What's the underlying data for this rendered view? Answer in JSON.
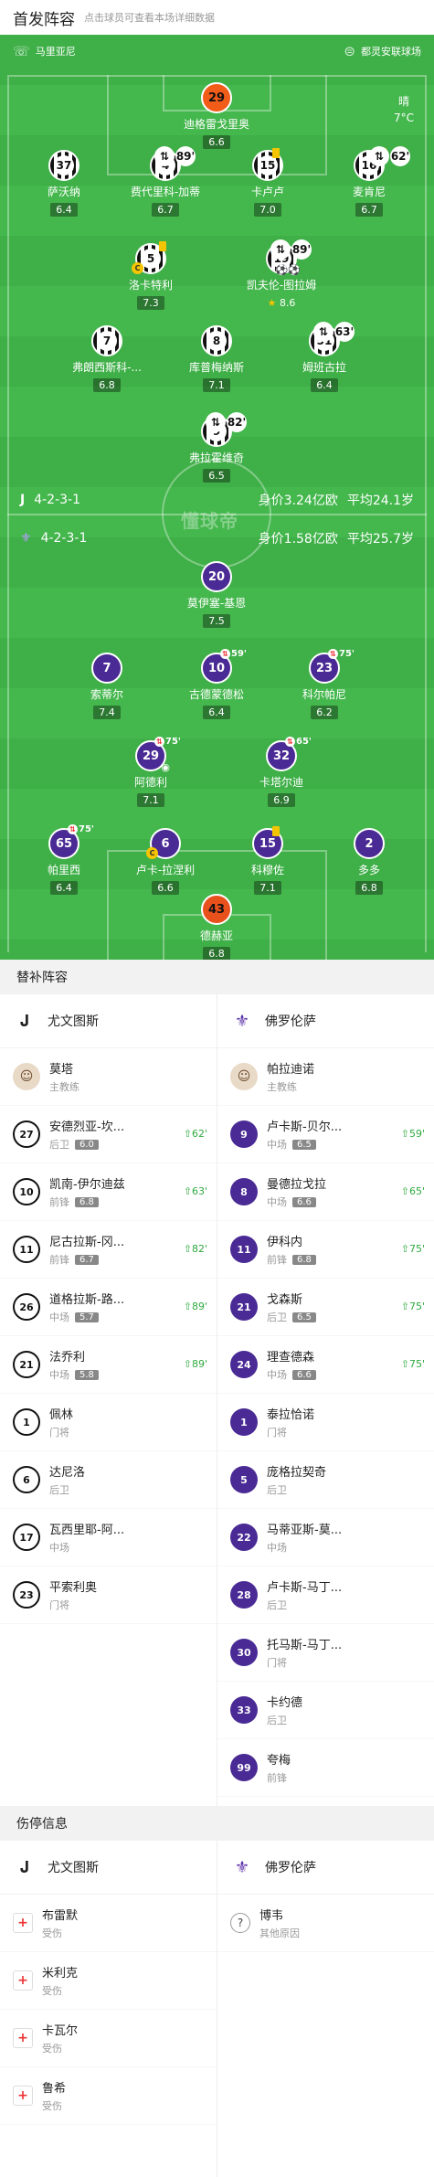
{
  "header": {
    "title": "首发阵容",
    "subtitle": "点击球员可查看本场详细数据"
  },
  "pitch": {
    "home_team": "马里亚尼",
    "away_team": "都灵安联球场",
    "weather": "晴",
    "temp": "7°C",
    "watermark": "懂球帝",
    "juve_formation": "4-2-3-1",
    "juve_value": "身价3.24亿欧",
    "juve_age": "平均24.1岁",
    "fio_formation": "4-2-3-1",
    "fio_value": "身价1.58亿欧",
    "fio_age": "平均25.7岁"
  },
  "juve_players": [
    {
      "num": "29",
      "name": "迪格雷戈里奥",
      "rating": "6.6"
    },
    {
      "num": "37",
      "name": "萨沃纳",
      "rating": "6.4"
    },
    {
      "num": "4",
      "name": "费代里科-加蒂",
      "rating": "6.7",
      "sub": "89'"
    },
    {
      "num": "15",
      "name": "卡卢卢",
      "rating": "7.0"
    },
    {
      "num": "16",
      "name": "麦肯尼",
      "rating": "6.7",
      "sub": "62'"
    },
    {
      "num": "5",
      "name": "洛卡特利",
      "rating": "7.3"
    },
    {
      "num": "19",
      "name": "凯夫伦-图拉姆",
      "rating": "8.6",
      "sub": "89'"
    },
    {
      "num": "7",
      "name": "弗朗西斯科-...",
      "rating": "6.8"
    },
    {
      "num": "8",
      "name": "库普梅纳斯",
      "rating": "7.1"
    },
    {
      "num": "51",
      "name": "姆班古拉",
      "rating": "6.4",
      "sub": "63'"
    },
    {
      "num": "9",
      "name": "弗拉霍维奇",
      "rating": "6.5",
      "sub": "82'"
    }
  ],
  "fio_players": [
    {
      "num": "20",
      "name": "莫伊塞-基恩",
      "rating": "7.5"
    },
    {
      "num": "7",
      "name": "索蒂尔",
      "rating": "7.4"
    },
    {
      "num": "10",
      "name": "古德蒙德松",
      "rating": "6.4",
      "sub": "59'"
    },
    {
      "num": "23",
      "name": "科尔帕尼",
      "rating": "6.2",
      "sub": "75'"
    },
    {
      "num": "29",
      "name": "阿德利",
      "rating": "7.1",
      "sub": "75'"
    },
    {
      "num": "32",
      "name": "卡塔尔迪",
      "rating": "6.9",
      "sub": "65'"
    },
    {
      "num": "65",
      "name": "帕里西",
      "rating": "6.4",
      "sub": "75'"
    },
    {
      "num": "6",
      "name": "卢卡-拉涅利",
      "rating": "6.6"
    },
    {
      "num": "15",
      "name": "科穆佐",
      "rating": "7.1"
    },
    {
      "num": "2",
      "name": "多多",
      "rating": "6.8"
    },
    {
      "num": "43",
      "name": "德赫亚",
      "rating": "6.8"
    }
  ],
  "subs_section": "替补阵容",
  "teams": {
    "juve": "尤文图斯",
    "fio": "佛罗伦萨"
  },
  "coaches": {
    "juve": {
      "name": "莫塔",
      "role": "主教练"
    },
    "fio": {
      "name": "帕拉迪诺",
      "role": "主教练"
    }
  },
  "juve_subs": [
    {
      "num": "27",
      "name": "安德烈亚-坎...",
      "pos": "后卫",
      "score": "6.0",
      "in": "62'"
    },
    {
      "num": "10",
      "name": "凯南-伊尔迪兹",
      "pos": "前锋",
      "score": "6.8",
      "in": "63'"
    },
    {
      "num": "11",
      "name": "尼古拉斯-冈...",
      "pos": "前锋",
      "score": "6.7",
      "in": "82'"
    },
    {
      "num": "26",
      "name": "道格拉斯-路...",
      "pos": "中场",
      "score": "5.7",
      "in": "89'"
    },
    {
      "num": "21",
      "name": "法乔利",
      "pos": "中场",
      "score": "5.8",
      "in": "89'"
    },
    {
      "num": "1",
      "name": "佩林",
      "pos": "门将"
    },
    {
      "num": "6",
      "name": "达尼洛",
      "pos": "后卫"
    },
    {
      "num": "17",
      "name": "瓦西里耶-阿...",
      "pos": "中场"
    },
    {
      "num": "23",
      "name": "平索利奥",
      "pos": "门将"
    }
  ],
  "fio_subs": [
    {
      "num": "9",
      "name": "卢卡斯-贝尔...",
      "pos": "中场",
      "score": "6.5",
      "in": "59'"
    },
    {
      "num": "8",
      "name": "曼德拉戈拉",
      "pos": "中场",
      "score": "6.6",
      "in": "65'"
    },
    {
      "num": "11",
      "name": "伊科内",
      "pos": "前锋",
      "score": "6.8",
      "in": "75'"
    },
    {
      "num": "21",
      "name": "戈森斯",
      "pos": "后卫",
      "score": "6.5",
      "in": "75'"
    },
    {
      "num": "24",
      "name": "理查德森",
      "pos": "中场",
      "score": "6.6",
      "in": "75'"
    },
    {
      "num": "1",
      "name": "泰拉恰诺",
      "pos": "门将"
    },
    {
      "num": "5",
      "name": "庞格拉契奇",
      "pos": "后卫"
    },
    {
      "num": "22",
      "name": "马蒂亚斯-莫...",
      "pos": "中场"
    },
    {
      "num": "28",
      "name": "卢卡斯-马丁...",
      "pos": "后卫"
    },
    {
      "num": "30",
      "name": "托马斯-马丁...",
      "pos": "门将"
    },
    {
      "num": "33",
      "name": "卡约德",
      "pos": "后卫"
    },
    {
      "num": "99",
      "name": "夸梅",
      "pos": "前锋"
    }
  ],
  "injury_section": "伤停信息",
  "juve_injuries": [
    {
      "name": "布雷默",
      "status": "受伤"
    },
    {
      "name": "米利克",
      "status": "受伤"
    },
    {
      "name": "卡瓦尔",
      "status": "受伤"
    },
    {
      "name": "鲁希",
      "status": "受伤"
    }
  ],
  "fio_injuries": [
    {
      "name": "博韦",
      "status": "其他原因"
    }
  ]
}
